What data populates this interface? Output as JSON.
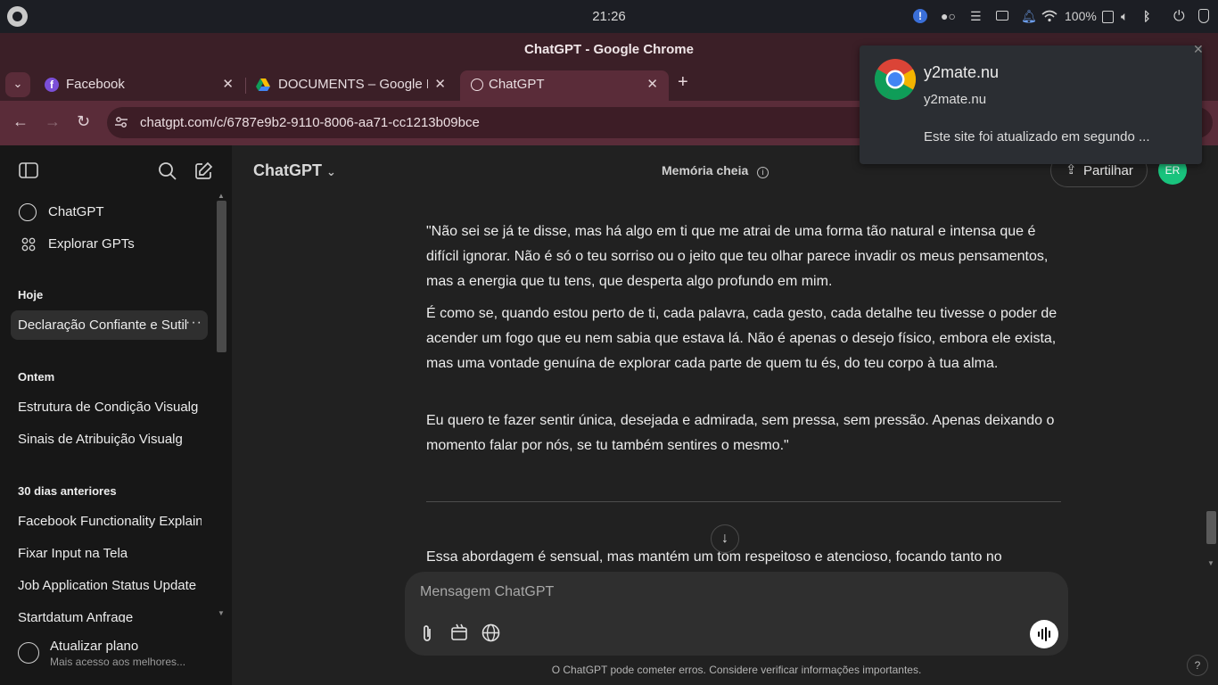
{
  "os": {
    "clock": "21:26",
    "battery": "100%"
  },
  "window": {
    "title": "ChatGPT - Google Chrome"
  },
  "tabs": [
    {
      "title": "Facebook",
      "icon": "facebook-icon"
    },
    {
      "title": "DOCUMENTS – Google Drive",
      "icon": "google-drive-icon"
    },
    {
      "title": "ChatGPT",
      "icon": "chatgpt-icon"
    }
  ],
  "address": {
    "url": "chatgpt.com/c/6787e9b2-9110-8006-aa71-cc1213b09bce"
  },
  "notification": {
    "title": "y2mate.nu",
    "source": "y2mate.nu",
    "message": "Este site foi atualizado em segundo ..."
  },
  "sidebar": {
    "top_items": [
      {
        "label": "ChatGPT",
        "icon": "chatgpt-icon"
      },
      {
        "label": "Explorar GPTs",
        "icon": "grid-icon"
      }
    ],
    "sections": [
      {
        "title": "Hoje",
        "items": [
          "Declaração Confiante e Sutil"
        ]
      },
      {
        "title": "Ontem",
        "items": [
          "Estrutura de Condição Visualg",
          "Sinais de Atribuição Visualg"
        ]
      },
      {
        "title": "30 dias anteriores",
        "items": [
          "Facebook Functionality Explained",
          "Fixar Input na Tela",
          "Job Application Status Update",
          "Startdatum Anfrage"
        ]
      }
    ],
    "upgrade": {
      "label": "Atualizar plano",
      "sub": "Mais acesso aos melhores..."
    }
  },
  "header": {
    "model": "ChatGPT",
    "memory": "Memória cheia",
    "share": "Partilhar",
    "avatar": "ER"
  },
  "conversation": {
    "paragraphs": [
      "\"Não sei se já te disse, mas há algo em ti que me atrai de uma forma tão natural e intensa que é difícil ignorar. Não é só o teu sorriso ou o jeito que teu olhar parece invadir os meus pensamentos, mas a energia que tu tens, que desperta algo profundo em mim.",
      "É como se, quando estou perto de ti, cada palavra, cada gesto, cada detalhe teu tivesse o poder de acender um fogo que eu nem sabia que estava lá. Não é apenas o desejo físico, embora ele exista, mas uma vontade genuína de explorar cada parte de quem tu és, do teu corpo à tua alma.",
      "Eu quero te fazer sentir única, desejada e admirada, sem pressa, sem pressão. Apenas deixando o momento falar por nós, se tu também sentires o mesmo.\""
    ],
    "followup": "Essa abordagem é sensual, mas mantém um tom respeitoso e atencioso, focando tanto no"
  },
  "composer": {
    "placeholder": "Mensagem ChatGPT",
    "disclaimer": "O ChatGPT pode cometer erros. Considere verificar informações importantes.",
    "help": "?"
  }
}
